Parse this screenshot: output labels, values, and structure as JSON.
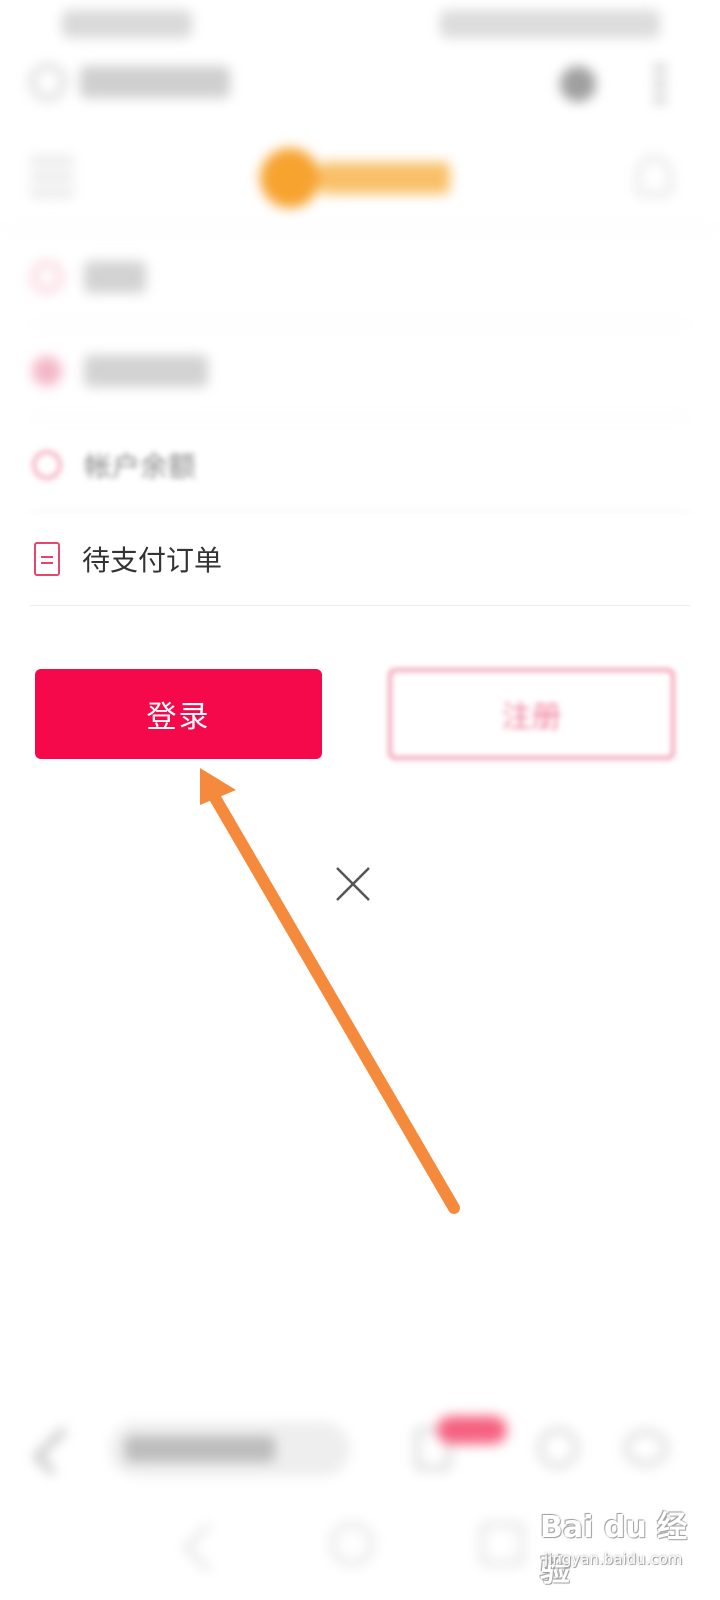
{
  "menu": {
    "items": [
      {
        "label": "帐户余额",
        "icon": "coin-icon"
      },
      {
        "label": "待支付订单",
        "icon": "document-icon"
      }
    ]
  },
  "buttons": {
    "login_label": "登录",
    "register_label": "注册"
  },
  "watermark": {
    "main": "Bai du 经验",
    "sub": "jingyan.baidu.com"
  },
  "colors": {
    "primary": "#f5094a",
    "register_border": "#e3486f",
    "arrow": "#f58a3c"
  }
}
